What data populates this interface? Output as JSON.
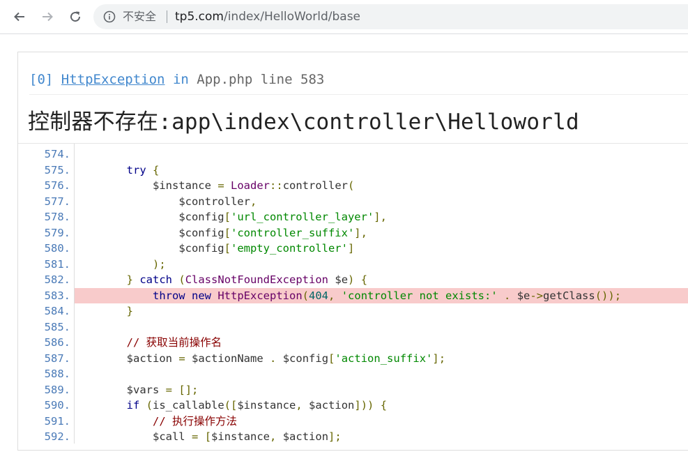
{
  "browser": {
    "security_text": "不安全",
    "url_host": "tp5.com",
    "url_path": "/index/HelloWorld/base"
  },
  "error": {
    "index": "[0]",
    "exception": "HttpException",
    "in_word": "in",
    "file_line": "App.php line 583",
    "message": "控制器不存在:app\\index\\controller\\Helloworld"
  },
  "code": {
    "highlight_line": "583.",
    "lines": [
      {
        "no": "574.",
        "text": ""
      },
      {
        "no": "575.",
        "text": "        try {"
      },
      {
        "no": "576.",
        "text": "            $instance = Loader::controller("
      },
      {
        "no": "577.",
        "text": "                $controller,"
      },
      {
        "no": "578.",
        "text": "                $config['url_controller_layer'],"
      },
      {
        "no": "579.",
        "text": "                $config['controller_suffix'],"
      },
      {
        "no": "580.",
        "text": "                $config['empty_controller']"
      },
      {
        "no": "581.",
        "text": "            );"
      },
      {
        "no": "582.",
        "text": "        } catch (ClassNotFoundException $e) {"
      },
      {
        "no": "583.",
        "text": "            throw new HttpException(404, 'controller not exists:' . $e->getClass());"
      },
      {
        "no": "584.",
        "text": "        }"
      },
      {
        "no": "585.",
        "text": ""
      },
      {
        "no": "586.",
        "text": "        // 获取当前操作名"
      },
      {
        "no": "587.",
        "text": "        $action = $actionName . $config['action_suffix'];"
      },
      {
        "no": "588.",
        "text": ""
      },
      {
        "no": "589.",
        "text": "        $vars = [];"
      },
      {
        "no": "590.",
        "text": "        if (is_callable([$instance, $action])) {"
      },
      {
        "no": "591.",
        "text": "            // 执行操作方法"
      },
      {
        "no": "592.",
        "text": "            $call = [$instance, $action];"
      }
    ]
  },
  "icons": {
    "back": "back-arrow-icon",
    "forward": "forward-arrow-icon",
    "reload": "reload-icon",
    "info": "info-icon"
  }
}
